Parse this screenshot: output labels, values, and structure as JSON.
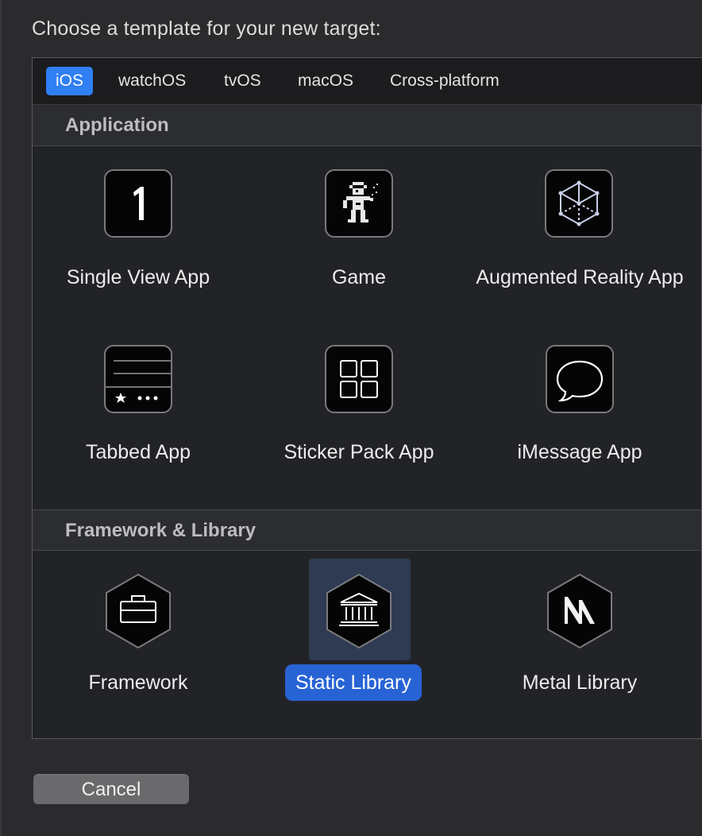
{
  "dialog": {
    "title": "Choose a template for your new target:"
  },
  "tabs": [
    {
      "label": "iOS",
      "active": true
    },
    {
      "label": "watchOS",
      "active": false
    },
    {
      "label": "tvOS",
      "active": false
    },
    {
      "label": "macOS",
      "active": false
    },
    {
      "label": "Cross-platform",
      "active": false
    }
  ],
  "sections": {
    "application": {
      "title": "Application",
      "items": [
        {
          "label": "Single View App",
          "icon": "number-one-icon"
        },
        {
          "label": "Game",
          "icon": "game-sprite-icon"
        },
        {
          "label": "Augmented Reality App",
          "icon": "ar-cube-icon"
        },
        {
          "label": "Tabbed App",
          "icon": "tab-bar-icon"
        },
        {
          "label": "Sticker Pack App",
          "icon": "sticker-grid-icon"
        },
        {
          "label": "iMessage App",
          "icon": "speech-bubble-icon"
        }
      ]
    },
    "framework": {
      "title": "Framework & Library",
      "items": [
        {
          "label": "Framework",
          "icon": "toolbox-icon"
        },
        {
          "label": "Static Library",
          "icon": "bank-building-icon",
          "selected": true
        },
        {
          "label": "Metal Library",
          "icon": "metal-logo-icon"
        }
      ]
    }
  },
  "footer": {
    "cancel_label": "Cancel"
  },
  "colors": {
    "accent": "#2f7ff5",
    "selection": "#2763d4",
    "background": "#222327"
  }
}
